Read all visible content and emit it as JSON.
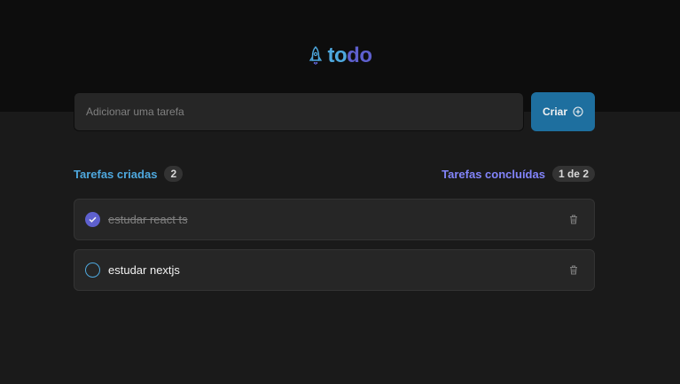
{
  "app": {
    "logo_part1": "to",
    "logo_part2": "do",
    "logo_icon": "rocket-icon"
  },
  "form": {
    "placeholder": "Adicionar uma tarefa",
    "value": "",
    "create_label": "Criar",
    "create_icon": "plus-circle-icon"
  },
  "info": {
    "created_label": "Tarefas criadas",
    "created_count": "2",
    "done_label": "Tarefas concluídas",
    "done_count": "1 de 2"
  },
  "tasks": [
    {
      "text": "estudar react ts",
      "completed": true
    },
    {
      "text": "estudar nextjs",
      "completed": false
    }
  ],
  "colors": {
    "blue": "#4ea8de",
    "purple": "#5e60ce",
    "purple_light": "#8284fa",
    "button": "#1e6f9f",
    "background": "#1a1a1a",
    "header": "#0d0d0d"
  }
}
